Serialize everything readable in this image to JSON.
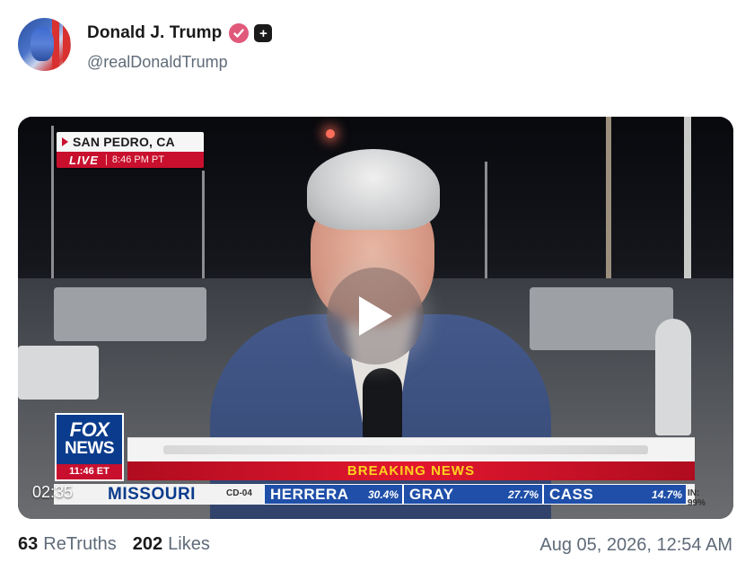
{
  "author": {
    "display_name": "Donald J. Trump",
    "handle": "@realDonaldTrump",
    "verified_icon": "verified-badge-icon",
    "plus_icon": "plus-badge-icon"
  },
  "video": {
    "location": "SAN PEDRO, CA",
    "live_label": "LIVE",
    "live_time": "8:46 PM PT",
    "network_logo_line1": "FOX",
    "network_logo_line2": "NEWS",
    "network_time": "11:46 ET",
    "banner": "BREAKING NEWS",
    "state": "MISSOURI",
    "district": "CD-04",
    "candidates": [
      {
        "name": "HERRERA",
        "pct": "30.4%"
      },
      {
        "name": "GRAY",
        "pct": "27.7%"
      },
      {
        "name": "CASS",
        "pct": "14.7%"
      }
    ],
    "reporting": "IN: 99%",
    "timer": "02:35",
    "play_icon": "play-icon"
  },
  "stats": {
    "retruths_count": "63",
    "retruths_label": "ReTruths",
    "likes_count": "202",
    "likes_label": "Likes"
  },
  "timestamp": "Aug 05, 2026, 12:54 AM",
  "colors": {
    "fox_red": "#c8102e",
    "fox_blue": "#0b3b8c",
    "banner_yellow": "#ffd21f",
    "verified_pink": "#e0587a"
  }
}
